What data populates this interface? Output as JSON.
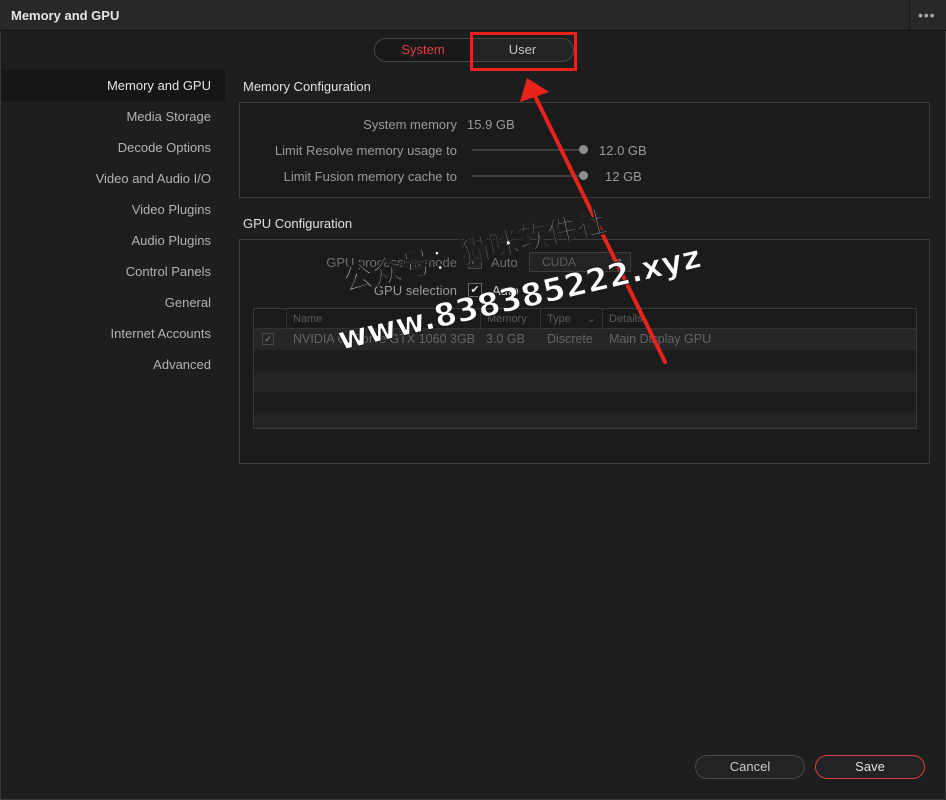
{
  "window": {
    "title": "Memory and GPU",
    "more_glyph": "•••"
  },
  "tabs": {
    "system": "System",
    "user": "User",
    "active": "System"
  },
  "sidebar": {
    "items": [
      {
        "label": "Memory and GPU",
        "active": true
      },
      {
        "label": "Media Storage"
      },
      {
        "label": "Decode Options"
      },
      {
        "label": "Video and Audio I/O"
      },
      {
        "label": "Video Plugins"
      },
      {
        "label": "Audio Plugins"
      },
      {
        "label": "Control Panels"
      },
      {
        "label": "General"
      },
      {
        "label": "Internet Accounts"
      },
      {
        "label": "Advanced"
      }
    ]
  },
  "memory": {
    "section_title": "Memory Configuration",
    "system_memory_label": "System memory",
    "system_memory_value": "15.9 GB",
    "resolve_limit_label": "Limit Resolve memory usage to",
    "resolve_limit_value": "12.0 GB",
    "fusion_limit_label": "Limit Fusion memory cache to",
    "fusion_limit_value": "12 GB"
  },
  "gpu": {
    "section_title": "GPU Configuration",
    "processing_mode_label": "GPU processing mode",
    "processing_mode_auto": "Auto",
    "processing_mode_checked": true,
    "processing_mode_value": "CUDA",
    "selection_label": "GPU selection",
    "selection_auto": "Auto",
    "selection_checked": true,
    "table": {
      "columns": [
        "Name",
        "Memory",
        "Type",
        "Details"
      ],
      "rows": [
        {
          "checked": true,
          "name": "NVIDIA GeForce GTX 1060 3GB",
          "memory": "3.0 GB",
          "type": "Discrete",
          "details": "Main Display GPU"
        }
      ]
    }
  },
  "footer": {
    "cancel": "Cancel",
    "save": "Save"
  },
  "annotation": {
    "watermark_line1": "公众号：猫咪软件社",
    "watermark_line2": "www.838385222.xyz",
    "highlight_color": "#e8231c"
  },
  "colors": {
    "accent": "#d9413e",
    "background": "#1e1e1f",
    "panel": "#1b1b1c"
  }
}
